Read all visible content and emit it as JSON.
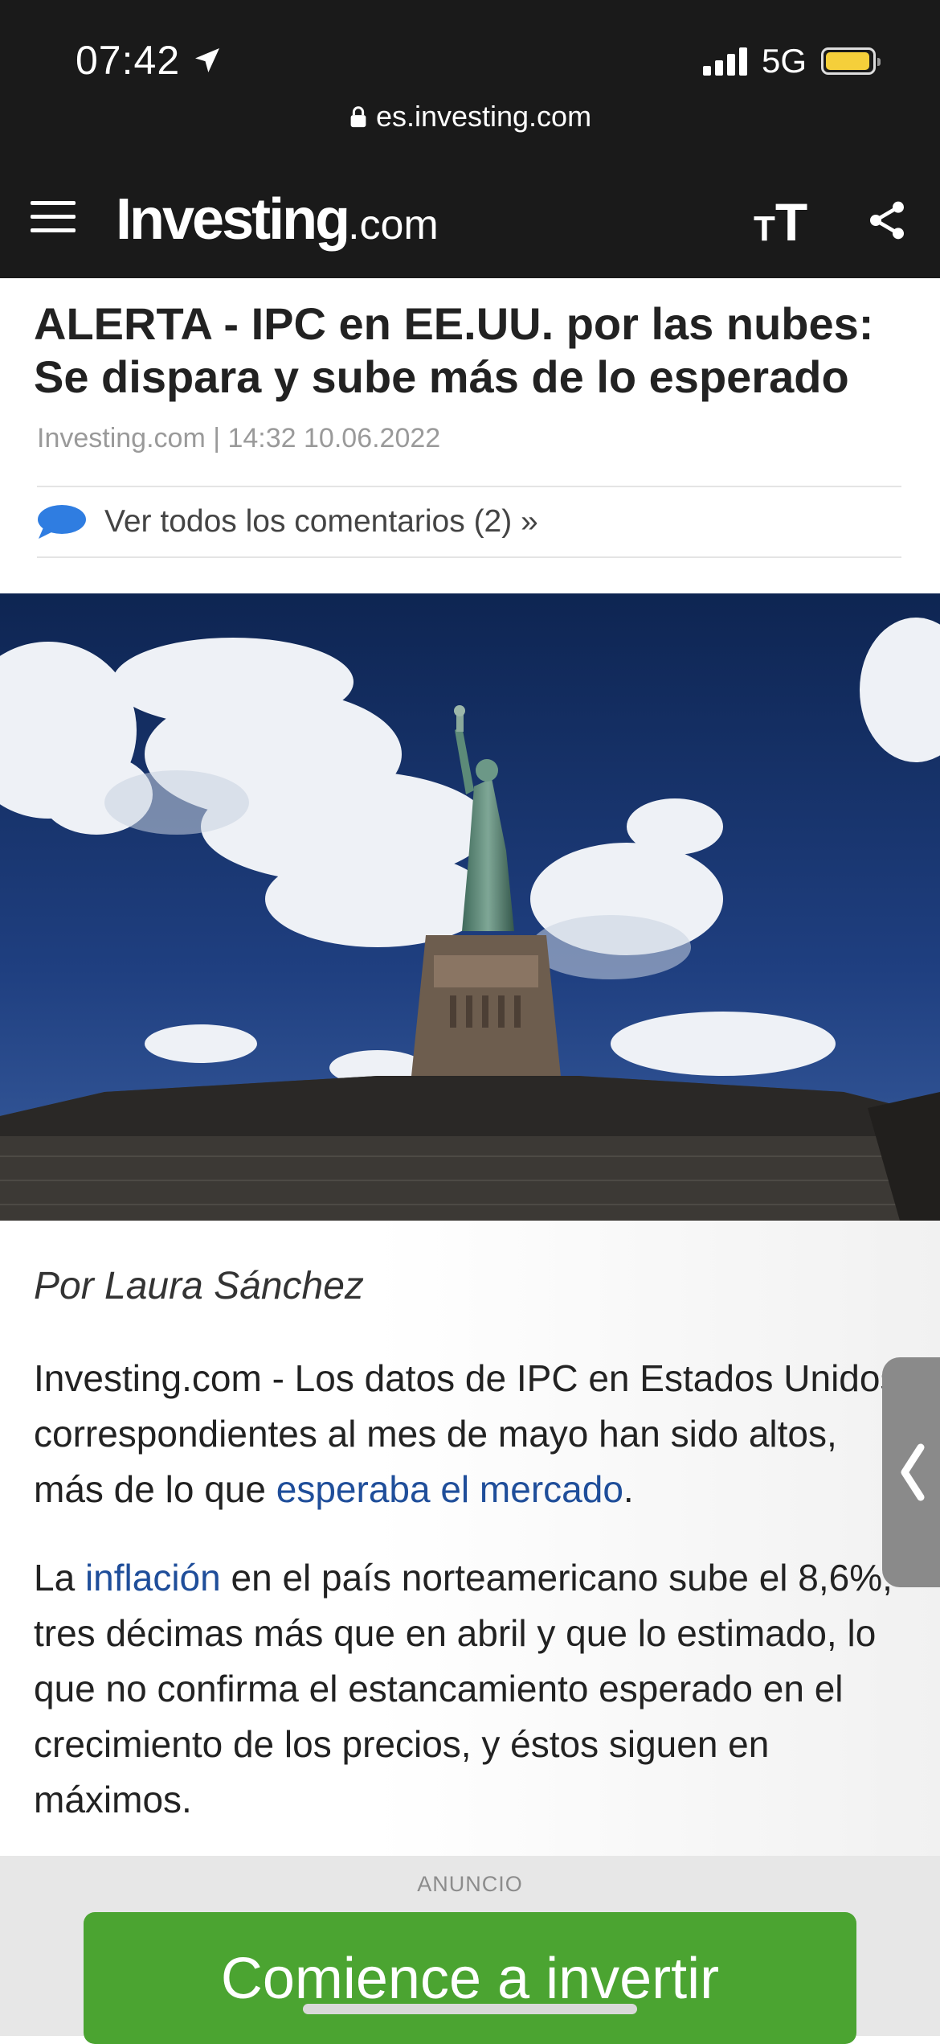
{
  "status": {
    "time": "07:42",
    "network": "5G"
  },
  "browser": {
    "url": "es.investing.com"
  },
  "header": {
    "logo_main": "Investing",
    "logo_suffix": ".com",
    "text_size_small": "T",
    "text_size_large": "T"
  },
  "article": {
    "title": "ALERTA - IPC en EE.UU. por las nubes: Se dispara y sube más de lo esperado",
    "meta": "Investing.com | 14:32 10.06.2022",
    "comments_link": "Ver todos los comentarios (2) »",
    "byline": "Por Laura Sánchez",
    "p1": {
      "text": "Investing.com - Los datos de IPC en Estados Unidos correspondientes al mes de mayo han sido altos, más de lo que ",
      "link": "esperaba el mercado",
      "end": "."
    },
    "p2": {
      "start": "La ",
      "link": "inflación",
      "text": " en el país norteamericano sube el 8,6%, tres décimas más que en abril y que lo estimado, lo que no confirma el estancamiento esperado en el crecimiento de los precios, y éstos siguen en máximos."
    }
  },
  "ad": {
    "label": "ANUNCIO",
    "cta": "Comience a invertir"
  },
  "colors": {
    "accent_green": "#4ba431",
    "link_blue": "#1f4e9a",
    "logo_orange": "#f39a1e"
  },
  "icons": [
    "location-arrow-icon",
    "signal-icon",
    "battery-icon",
    "lock-icon",
    "menu-icon",
    "text-size-icon",
    "share-icon",
    "comment-bubble-icon",
    "chevron-left-icon"
  ]
}
